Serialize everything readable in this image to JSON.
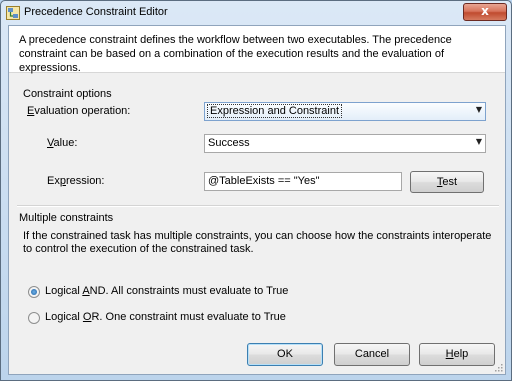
{
  "window": {
    "title": "Precedence Constraint Editor",
    "close_glyph": "x",
    "title_icon": "precedence-editor-icon"
  },
  "intro": {
    "text": "A precedence constraint defines the workflow between two executables. The precedence constraint can be based on a combination of the execution results and the evaluation of expressions."
  },
  "constraint_options": {
    "heading": "Constraint options",
    "evaluation_operation": {
      "label_pre": "",
      "label_accel": "E",
      "label_post": "valuation operation:",
      "value": "Expression and Constraint"
    },
    "value_field": {
      "label_pre": "",
      "label_accel": "V",
      "label_post": "alue:",
      "value": "Success"
    },
    "expression": {
      "label_pre": "Ex",
      "label_accel": "p",
      "label_post": "ression:",
      "value": "@TableExists == \"Yes\""
    },
    "test_button": {
      "pre": "",
      "accel": "T",
      "post": "est"
    }
  },
  "multiple_constraints": {
    "heading": "Multiple constraints",
    "description": "If the constrained task has multiple constraints, you can choose how the constraints interoperate to control the execution of the constrained task.",
    "options": [
      {
        "pre": "Logical ",
        "accel": "A",
        "post": "ND. All constraints must evaluate to True",
        "checked": true
      },
      {
        "pre": "Logical ",
        "accel": "O",
        "post": "R. One constraint must evaluate to True",
        "checked": false
      }
    ]
  },
  "buttons": {
    "ok": "OK",
    "cancel": "Cancel",
    "help": {
      "pre": "",
      "accel": "H",
      "post": "elp"
    }
  }
}
